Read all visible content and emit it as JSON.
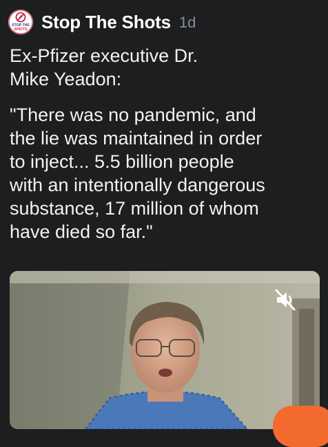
{
  "post": {
    "author": "Stop The Shots",
    "avatar_text": [
      "STOP THE",
      "SHOTS"
    ],
    "time": "1d",
    "intro_lines": [
      "Ex-Pfizer executive Dr.",
      "Mike Yeadon:"
    ],
    "quote_lines": [
      "\"There was no pandemic, and",
      "the lie was maintained in order",
      "to inject... 5.5 billion people",
      "with an intentionally dangerous",
      "substance, 17 million of whom",
      "have died so far.\""
    ]
  },
  "video": {
    "mute_icon": "speaker-muted-icon"
  },
  "colors": {
    "background": "#1c1e20",
    "text": "#f2f2f2",
    "muted_text": "#8a8d91",
    "accent": "#f26a2e",
    "logo_red": "#d11f2f",
    "logo_blue": "#1f3f8f"
  }
}
